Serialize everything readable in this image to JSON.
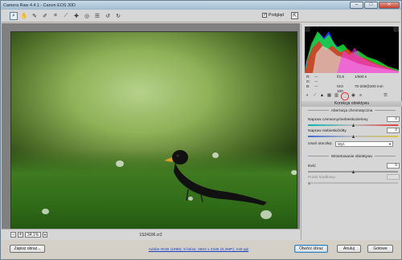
{
  "window": {
    "title": "Camera Raw 4.4.1  -  Canon EOS 30D",
    "minimize": "–",
    "maximize": "□",
    "close": "✕"
  },
  "toolbar": {
    "preview_label": "Podgląd",
    "preview_checked": true,
    "tools": [
      "zoom-tool",
      "hand-tool",
      "white-balance-tool",
      "color-sampler-tool",
      "crop-tool",
      "straighten-tool",
      "retouch-tool",
      "red-eye-tool",
      "preferences",
      "rotate-left",
      "rotate-right"
    ]
  },
  "status": {
    "zoom": "34,1%",
    "filename": "1S24106.cr2"
  },
  "readout": {
    "r_label": "R:",
    "r_value": "---",
    "g_label": "G:",
    "g_value": "---",
    "b_label": "B:",
    "b_value": "---",
    "aperture": "f/2,8",
    "shutter": "1/500 s",
    "iso": "ISO 100",
    "lens": "70-200@200 mm"
  },
  "panel": {
    "section_title": "Korekcja obiektywu",
    "chromatic_title": "Aberracja chromatyczna",
    "fix_red_cyan_label": "Napraw czerwony/niebieskozielony",
    "fix_red_cyan_value": "0",
    "fix_blue_yellow_label": "Napraw niebieski/żółty",
    "fix_blue_yellow_value": "0",
    "defringe_label": "Usuń otoczkę:",
    "defringe_value": "Wył.",
    "vignetting_title": "Winietowanie obiektywu",
    "amount_label": "Ilość",
    "amount_value": "0",
    "midpoint_label": "Punkt środkowy",
    "midpoint_value": ""
  },
  "buttons": {
    "save": "Zapisz obraz...",
    "open": "Otwórz obraz",
    "cancel": "Anuluj",
    "done": "Gotowe"
  },
  "workflow_link": "Adobe RGB (1998); 8 bitów; 3504 x 2336 (8,2MP); 240 ppi"
}
